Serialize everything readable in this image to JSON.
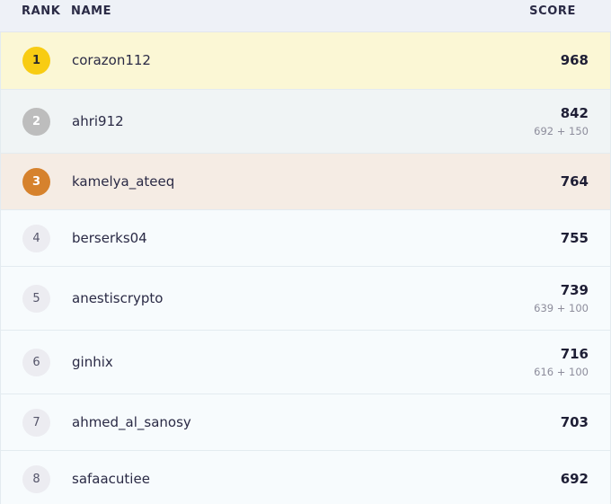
{
  "header": {
    "rank_label": "RANK",
    "name_label": "NAME",
    "score_label": "SCORE"
  },
  "colors": {
    "gold": "#f8cc13",
    "silver": "#bdbdbd",
    "bronze": "#d6822d",
    "gold_row": "#fbf7d5",
    "silver_row": "#f0f4f5",
    "bronze_row": "#f5ece4",
    "default_row": "#f7fbfd",
    "default_badge": "#ececf1"
  },
  "rows": [
    {
      "rank": "1",
      "name": "corazon112",
      "score": "968",
      "breakdown": ""
    },
    {
      "rank": "2",
      "name": "ahri912",
      "score": "842",
      "breakdown": "692 + 150"
    },
    {
      "rank": "3",
      "name": "kamelya_ateeq",
      "score": "764",
      "breakdown": ""
    },
    {
      "rank": "4",
      "name": "berserks04",
      "score": "755",
      "breakdown": ""
    },
    {
      "rank": "5",
      "name": "anestiscrypto",
      "score": "739",
      "breakdown": "639 + 100"
    },
    {
      "rank": "6",
      "name": "ginhix",
      "score": "716",
      "breakdown": "616 + 100"
    },
    {
      "rank": "7",
      "name": "ahmed_al_sanosy",
      "score": "703",
      "breakdown": ""
    },
    {
      "rank": "8",
      "name": "safaacutiee",
      "score": "692",
      "breakdown": ""
    }
  ]
}
